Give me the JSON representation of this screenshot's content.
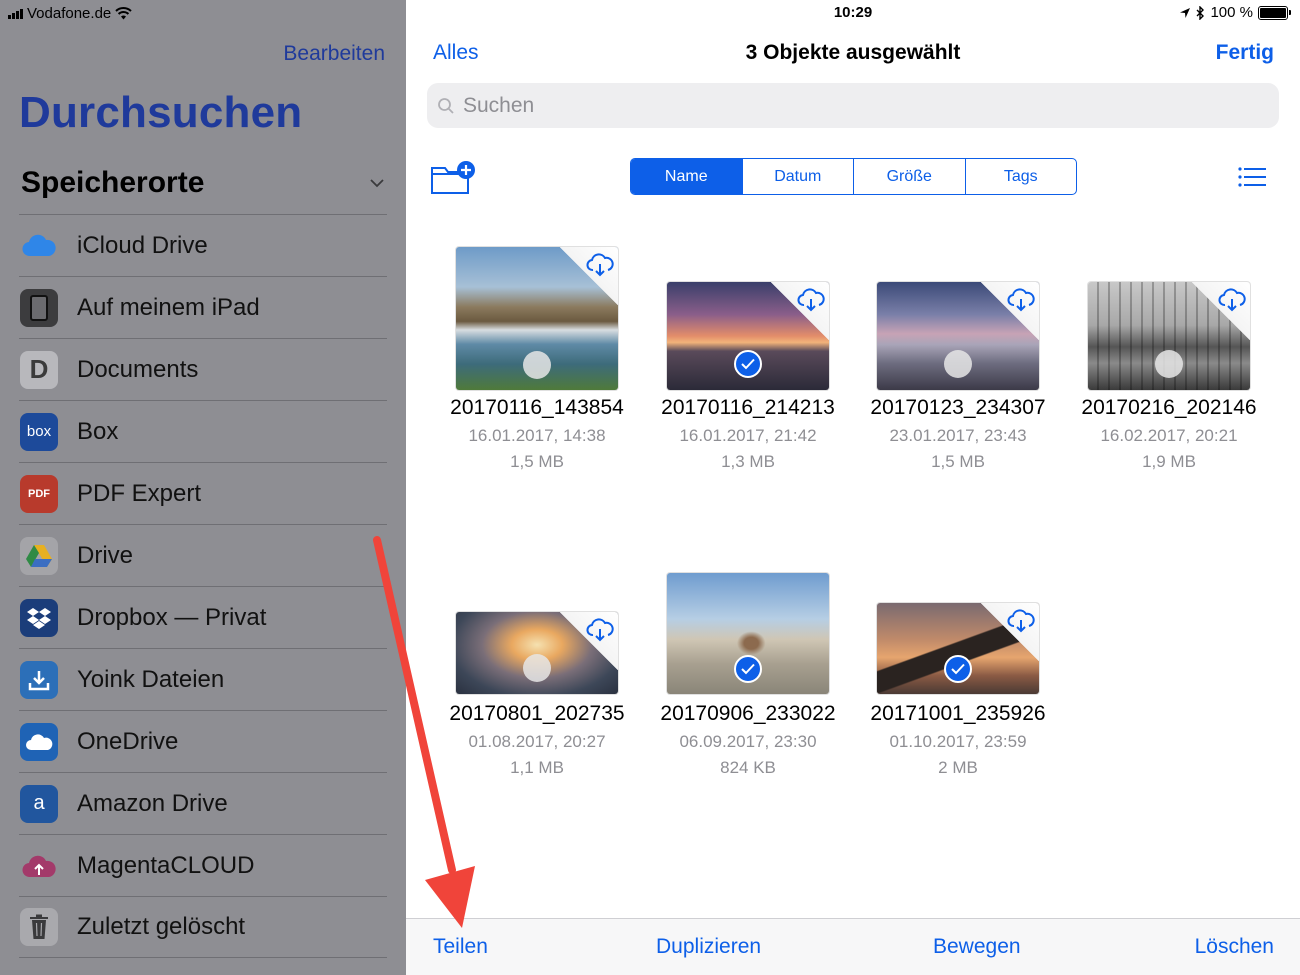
{
  "status": {
    "carrier": "Vodafone.de",
    "time": "10:29",
    "battery": "100 %"
  },
  "sidebar": {
    "edit_label": "Bearbeiten",
    "title": "Durchsuchen",
    "section": "Speicherorte",
    "items": [
      {
        "label": "iCloud Drive",
        "icon": "icloud-icon"
      },
      {
        "label": "Auf meinem iPad",
        "icon": "ipad-icon"
      },
      {
        "label": "Documents",
        "icon": "documents-icon"
      },
      {
        "label": "Box",
        "icon": "box-icon"
      },
      {
        "label": "PDF Expert",
        "icon": "pdf-expert-icon"
      },
      {
        "label": "Drive",
        "icon": "google-drive-icon"
      },
      {
        "label": "Dropbox — Privat",
        "icon": "dropbox-icon"
      },
      {
        "label": "Yoink Dateien",
        "icon": "yoink-icon"
      },
      {
        "label": "OneDrive",
        "icon": "onedrive-icon"
      },
      {
        "label": "Amazon Drive",
        "icon": "amazon-drive-icon"
      },
      {
        "label": "MagentaCLOUD",
        "icon": "magentacloud-icon"
      },
      {
        "label": "Zuletzt gelöscht",
        "icon": "trash-icon"
      }
    ]
  },
  "main": {
    "nav": {
      "left": "Alles",
      "title": "3 Objekte ausgewählt",
      "right": "Fertig"
    },
    "search": {
      "placeholder": "Suchen"
    },
    "sort": {
      "options": [
        "Name",
        "Datum",
        "Größe",
        "Tags"
      ],
      "selected": "Name"
    },
    "files": [
      {
        "name": "20170116_143854",
        "date": "16.01.2017, 14:38",
        "size": "1,5 MB",
        "selected": false
      },
      {
        "name": "20170116_214213",
        "date": "16.01.2017, 21:42",
        "size": "1,3 MB",
        "selected": true
      },
      {
        "name": "20170123_234307",
        "date": "23.01.2017, 23:43",
        "size": "1,5 MB",
        "selected": false
      },
      {
        "name": "20170216_202146",
        "date": "16.02.2017, 20:21",
        "size": "1,9 MB",
        "selected": false
      },
      {
        "name": "20170801_202735",
        "date": "01.08.2017, 20:27",
        "size": "1,1 MB",
        "selected": false
      },
      {
        "name": "20170906_233022",
        "date": "06.09.2017, 23:30",
        "size": "824 KB",
        "selected": true
      },
      {
        "name": "20171001_235926",
        "date": "01.10.2017, 23:59",
        "size": "2 MB",
        "selected": true
      }
    ],
    "toolbar": {
      "share": "Teilen",
      "duplicate": "Duplizieren",
      "move": "Bewegen",
      "delete": "Löschen"
    }
  },
  "colors": {
    "accent": "#0d5fe8",
    "sidebar_bg": "#8e8e93",
    "sidebar_accent": "#1f3a9b",
    "arrow": "#f0443a"
  }
}
